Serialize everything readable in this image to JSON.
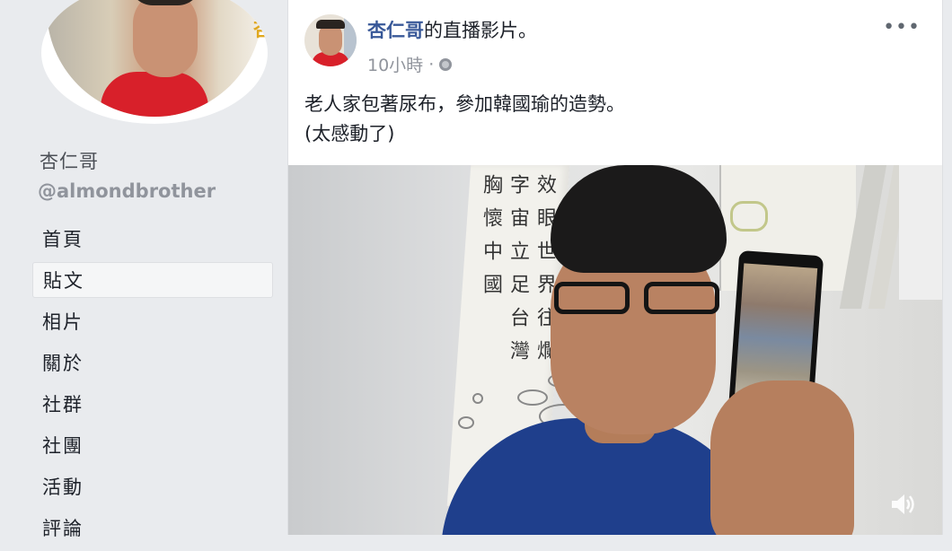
{
  "sidebar": {
    "profile_sign": "山\n杏",
    "page_name": "杏仁哥",
    "handle": "@almondbrother",
    "nav": [
      {
        "label": "首頁",
        "active": false
      },
      {
        "label": "貼文",
        "active": true
      },
      {
        "label": "相片",
        "active": false
      },
      {
        "label": "關於",
        "active": false
      },
      {
        "label": "社群",
        "active": false
      },
      {
        "label": "社團",
        "active": false
      },
      {
        "label": "活動",
        "active": false
      },
      {
        "label": "評論",
        "active": false
      }
    ]
  },
  "post": {
    "author": "杏仁哥",
    "action": "的直播影片。",
    "time": "10小時",
    "separator": "·",
    "text_line1": "老人家包著尿布，參加韓國瑜的造勢。",
    "text_line2": "(太感動了)",
    "more": "•••",
    "video": {
      "scroll_text": "效 眼 世 界 往 爛 字 宙 立 足 台 灣 胸 懷 中 國"
    }
  },
  "icons": {
    "globe": "globe-icon",
    "more": "more-icon",
    "volume": "volume-icon"
  },
  "colors": {
    "link": "#385898",
    "background": "#e9ebee",
    "shirt": "#1f3f8c"
  }
}
